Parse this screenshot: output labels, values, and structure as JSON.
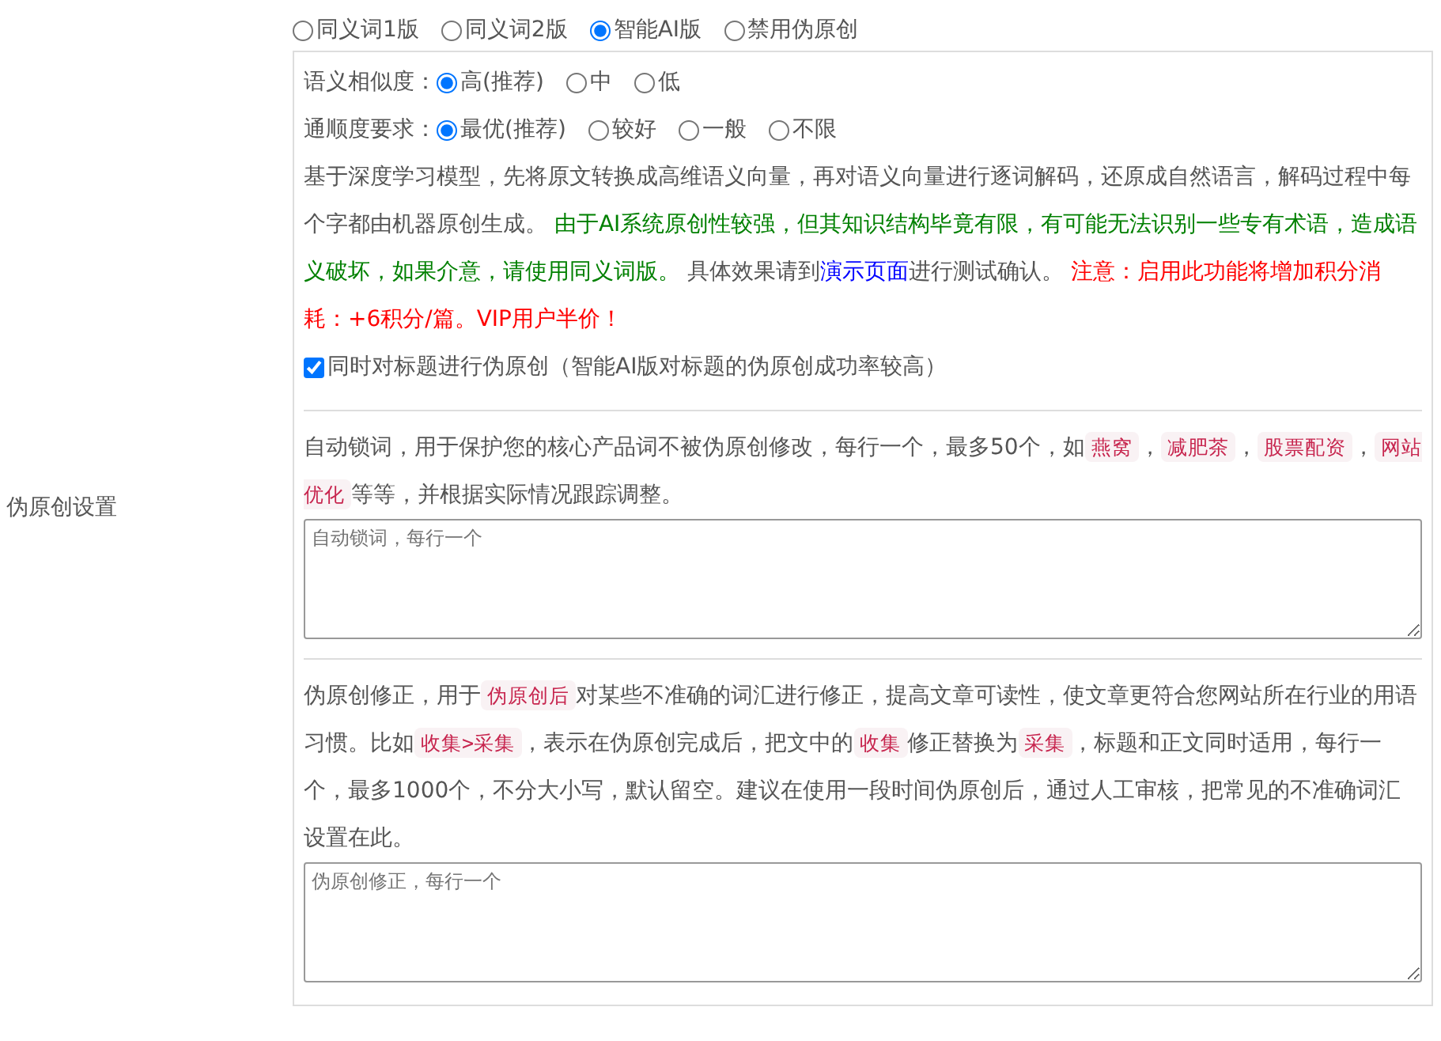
{
  "section_label": "伪原创设置",
  "mode_options": [
    {
      "label": "同义词1版",
      "selected": false
    },
    {
      "label": "同义词2版",
      "selected": false
    },
    {
      "label": "智能AI版",
      "selected": true
    },
    {
      "label": "禁用伪原创",
      "selected": false
    }
  ],
  "similarity": {
    "label": "语义相似度：",
    "options": [
      {
        "label": "高(推荐)",
        "selected": true
      },
      {
        "label": "中",
        "selected": false
      },
      {
        "label": "低",
        "selected": false
      }
    ]
  },
  "fluency": {
    "label": "通顺度要求：",
    "options": [
      {
        "label": "最优(推荐)",
        "selected": true
      },
      {
        "label": "较好",
        "selected": false
      },
      {
        "label": "一般",
        "selected": false
      },
      {
        "label": "不限",
        "selected": false
      }
    ]
  },
  "ai_description": [
    {
      "kind": "plain",
      "text": "基于深度学习模型，先将原文转换成高维语义向量，再对语义向量进行逐词解码，还原成自然语言，解码过程中每个字都由机器原创生成。 "
    },
    {
      "kind": "green",
      "text": "由于AI系统原创性较强，但其知识结构毕竟有限，有可能无法识别一些专有术语，造成语义破坏，如果介意，请使用同义词版。"
    },
    {
      "kind": "plain",
      "text": " 具体效果请到"
    },
    {
      "kind": "link",
      "text": "演示页面"
    },
    {
      "kind": "plain",
      "text": "进行测试确认。 "
    },
    {
      "kind": "red",
      "text": "注意：启用此功能将增加积分消耗：+6积分/篇。VIP用户半价！"
    }
  ],
  "title_option": {
    "label": "同时对标题进行伪原创（智能AI版对标题的伪原创成功率较高）",
    "checked": true
  },
  "lock_words": {
    "description": [
      {
        "kind": "plain",
        "text": "自动锁词，用于保护您的核心产品词不被伪原创修改，每行一个，最多50个，如"
      },
      {
        "kind": "code",
        "text": "燕窝"
      },
      {
        "kind": "plain",
        "text": "，"
      },
      {
        "kind": "code",
        "text": "减肥茶"
      },
      {
        "kind": "plain",
        "text": "，"
      },
      {
        "kind": "code",
        "text": "股票配资"
      },
      {
        "kind": "plain",
        "text": "，"
      },
      {
        "kind": "code",
        "text": "网站优化"
      },
      {
        "kind": "plain",
        "text": "等等，并根据实际情况跟踪调整。"
      }
    ],
    "placeholder": "自动锁词，每行一个"
  },
  "corrections": {
    "description": [
      {
        "kind": "plain",
        "text": "伪原创修正，用于"
      },
      {
        "kind": "code",
        "text": "伪原创后"
      },
      {
        "kind": "plain",
        "text": "对某些不准确的词汇进行修正，提高文章可读性，使文章更符合您网站所在行业的用语习惯。比如"
      },
      {
        "kind": "code",
        "text": "收集>采集"
      },
      {
        "kind": "plain",
        "text": "，表示在伪原创完成后，把文中的"
      },
      {
        "kind": "code",
        "text": "收集"
      },
      {
        "kind": "plain",
        "text": "修正替换为"
      },
      {
        "kind": "code",
        "text": "采集"
      },
      {
        "kind": "plain",
        "text": "，标题和正文同时适用，每行一个，最多1000个，不分大小写，默认留空。建议在使用一段时间伪原创后，通过人工审核，把常见的不准确词汇设置在此。"
      }
    ],
    "placeholder": "伪原创修正，每行一个"
  }
}
